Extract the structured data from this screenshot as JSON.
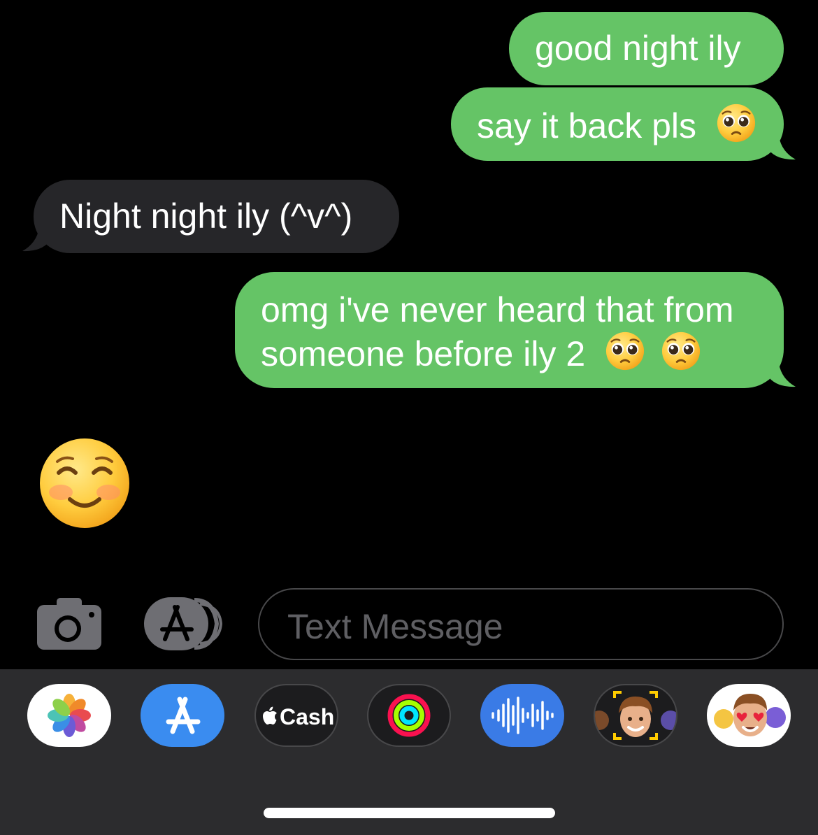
{
  "messages": [
    {
      "direction": "outgoing",
      "text": "good night ily",
      "emoji": ""
    },
    {
      "direction": "outgoing",
      "text": "say it back pls",
      "emoji": "pleading-face"
    },
    {
      "direction": "incoming",
      "text": "Night night ily (^v^)",
      "emoji": ""
    },
    {
      "direction": "outgoing",
      "line1": "omg i've never heard that from",
      "line2": "someone before ily 2",
      "emoji": "pleading-face x2"
    },
    {
      "direction": "incoming",
      "emoji": "smiling-face-with-blushing-eyes"
    }
  ],
  "composer": {
    "placeholder": "Text Message"
  },
  "app_drawer": {
    "cash_label": "Cash",
    "apps": [
      "photos",
      "app-store",
      "apple-cash",
      "activity",
      "audio-message",
      "memoji",
      "memoji-stickers"
    ]
  },
  "colors": {
    "outgoing_bubble": "#65c466",
    "incoming_bubble": "#262629",
    "background": "#000000",
    "drawer": "#2c2c2e"
  }
}
